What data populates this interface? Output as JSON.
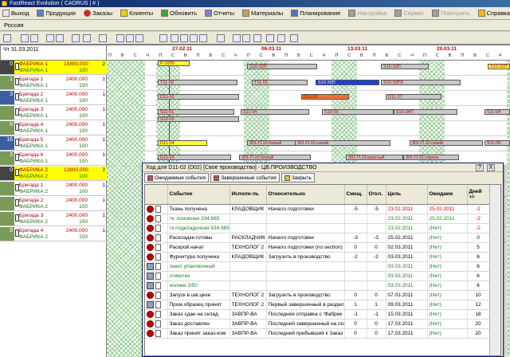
{
  "app": {
    "title": "FastReact Evolution  ( CADRUS | # )"
  },
  "menu": [
    {
      "label": "Выход",
      "icon": "exit-icon",
      "disabled": false
    },
    {
      "label": "Продукция",
      "icon": "product-icon",
      "disabled": false
    },
    {
      "label": "Заказы",
      "icon": "orders-icon",
      "disabled": false
    },
    {
      "label": "Клиенты",
      "icon": "clients-icon",
      "disabled": false
    },
    {
      "label": "Обновить",
      "icon": "refresh-icon",
      "disabled": false
    },
    {
      "label": "Отчеты",
      "icon": "reports-icon",
      "disabled": false
    },
    {
      "label": "Материалы",
      "icon": "materials-icon",
      "disabled": false
    },
    {
      "label": "Планирование",
      "icon": "planning-icon",
      "disabled": false
    },
    {
      "label": "Настройка",
      "icon": "settings-icon",
      "disabled": true
    },
    {
      "label": "Сервис",
      "icon": "service-icon",
      "disabled": true
    },
    {
      "label": "Повторить",
      "icon": "repeat-icon",
      "disabled": true
    },
    {
      "label": "Справка",
      "icon": "help-icon",
      "disabled": false
    }
  ],
  "region": "Россия",
  "current_date": "Чт 31.03.2011",
  "timeline": {
    "dates": [
      "27.02.11",
      "06.03.11",
      "13.03.11",
      "20.03.11"
    ],
    "days": [
      "П",
      "В",
      "С",
      "Ч",
      "П",
      "С",
      "В"
    ]
  },
  "resources": [
    {
      "num": "0",
      "name": "ФАБРИКА 1",
      "sub": "ФАБРИКА 1",
      "value": "15800,000",
      "sub_value": "100",
      "count": "2",
      "highlight": true
    },
    {
      "num": "1",
      "name": "Бригада 1",
      "sub": "ФАБРИКА 1",
      "value": "2400,000",
      "sub_value": "100",
      "count": "1",
      "highlight": false
    },
    {
      "num": "3",
      "name": "Бригада 2",
      "sub": "ФАБРИКА 1",
      "value": "2400,000",
      "sub_value": "100",
      "count": "1",
      "highlight": false
    },
    {
      "num": "",
      "name": "Бригада 3",
      "sub": "ФАБРИКА 1",
      "value": "2400,000",
      "sub_value": "100",
      "count": "1",
      "highlight": false
    },
    {
      "num": "8",
      "name": "Бригада 4",
      "sub": "ФАБРИКА 1",
      "value": "2400,000",
      "sub_value": "100",
      "count": "1",
      "highlight": false
    },
    {
      "num": "16",
      "name": "Бригада 5",
      "sub": "ФАБРИКА 1",
      "value": "2400,000",
      "sub_value": "100",
      "count": "1",
      "highlight": false
    },
    {
      "num": "3",
      "name": "Бригада 6",
      "sub": "ФАБРИКА 1",
      "value": "2400,000",
      "sub_value": "100",
      "count": "1",
      "highlight": false
    },
    {
      "num": "0",
      "name": "ФАБРИКА 2",
      "sub": "ФАБРИКА 2",
      "value": "12800,000",
      "sub_value": "100",
      "count": "2",
      "highlight": true
    },
    {
      "num": "",
      "name": "Бригада 1",
      "sub": "ФАБРИКА 2",
      "value": "2400,000",
      "sub_value": "100",
      "count": "1",
      "highlight": false
    },
    {
      "num": "",
      "name": "Бригада 2",
      "sub": "ФАБРИКА 2",
      "value": "2400,000",
      "sub_value": "100",
      "count": "1",
      "highlight": false
    },
    {
      "num": "",
      "name": "Бригада 3",
      "sub": "ФАБРИКА 2",
      "value": "2400,000",
      "sub_value": "100",
      "count": "1",
      "highlight": false
    },
    {
      "num": "8",
      "name": "Бригада 4",
      "sub": "ФАБРИКА 2",
      "value": "2400,000",
      "sub_value": "100",
      "count": "1",
      "highlight": false
    }
  ],
  "gantt_labels": [
    "P-1009",
    "S10-32П",
    "S10-33П",
    "S10-32П",
    "T11-02",
    "T11-01",
    "S10-33П",
    "S10-33П3",
    "D11-02",
    "D11-02",
    "D11-37",
    "S11-01",
    "S11-04",
    "S10-03",
    "S10-34П",
    "S11-04",
    "S10-03",
    "D11-04",
    "301-П.10:белый",
    "301-П.10:синий",
    "301-П.10:синий",
    "S11-05",
    "D11-03",
    "301-П.10:белый",
    "301-П.10:красный",
    "301-П.10:сирень"
  ],
  "dialog": {
    "title": "Ход для D11-02  (D02) [Свое производство] - ЦВ.ПРОИЗВОДСТВО",
    "help_btn": "?",
    "close_btn": "X",
    "tabs": [
      "Ожидаемые события",
      "Завершенные события",
      "Закрыть"
    ],
    "columns": [
      "Событие",
      "Исполн-ль",
      "Относительно",
      "Смещ.",
      "Откл.",
      "Цель",
      "Ожидаем",
      "Дней +/-"
    ],
    "rows": [
      {
        "event": "Ткань получена",
        "who": "КЛАДОВЩИК",
        "rel": "Начало подготовки",
        "shift": "-5",
        "dev": "-5",
        "target": "23.02.2011",
        "expected": "25.02.2011",
        "days": "-2",
        "color": "black",
        "target_red": true,
        "icon": "circle"
      },
      {
        "event": "тк. основная 334.665",
        "who": "",
        "rel": "",
        "shift": "",
        "dev": "",
        "target": "23.02.2011",
        "expected": "25.02.2011",
        "days": "-2",
        "color": "green",
        "target_red": false,
        "icon": "circle"
      },
      {
        "event": "тк.подкладочная 534.665",
        "who": "",
        "rel": "",
        "shift": "",
        "dev": "",
        "target": "23.02.2011",
        "expected": "(Нет)",
        "days": "-2",
        "color": "green",
        "target_red": false,
        "icon": "circle"
      },
      {
        "event": "Раскладки готовы",
        "who": "РАСКЛАДЧИК",
        "rel": "Начало подготовки",
        "shift": "-3",
        "dev": "-3",
        "target": "25.02.2011",
        "expected": "(Нет)",
        "days": "0",
        "color": "black",
        "target_red": false,
        "icon": "circle"
      },
      {
        "event": "Раскрой начат",
        "who": "ТЕХНОЛОГ 2",
        "rel": "Начало подготовки (no section)",
        "shift": "0",
        "dev": "0",
        "target": "02.03.2011",
        "expected": "(Нет)",
        "days": "5",
        "color": "black",
        "target_red": false,
        "icon": "circle"
      },
      {
        "event": "Фурнитура получена",
        "who": "КЛАДОВЩИК",
        "rel": "Загрузить в производство",
        "shift": "-2",
        "dev": "-2",
        "target": "03.03.2011",
        "expected": "(Нет)",
        "days": "6",
        "color": "black",
        "target_red": false,
        "icon": "circle"
      },
      {
        "event": "пакет упаковочный",
        "who": "",
        "rel": "",
        "shift": "",
        "dev": "",
        "target": "03.03.2011",
        "expected": "(Нет)",
        "days": "6",
        "color": "green",
        "target_red": false,
        "icon": "people"
      },
      {
        "event": "этикетки",
        "who": "",
        "rel": "",
        "shift": "",
        "dev": "",
        "target": "03.03.2011",
        "expected": "(Нет)",
        "days": "6",
        "color": "green",
        "target_red": false,
        "icon": "people"
      },
      {
        "event": "нолики 3/50",
        "who": "",
        "rel": "",
        "shift": "",
        "dev": "",
        "target": "03.03.2011",
        "expected": "(Нет)",
        "days": "6",
        "color": "green",
        "target_red": false,
        "icon": "people"
      },
      {
        "event": "Запуск в шв.цехе",
        "who": "ТЕХНОЛОГ 2",
        "rel": "Загрузить в производство",
        "shift": "0",
        "dev": "0",
        "target": "07.03.2011",
        "expected": "(Нет)",
        "days": "10",
        "color": "black",
        "target_red": false,
        "icon": "circle"
      },
      {
        "event": "Пром.образец принят",
        "who": "ТЕХНОЛОГ 2",
        "rel": "Первый завершенный в раздел",
        "shift": "1",
        "dev": "1",
        "target": "09.03.2011",
        "expected": "(Нет)",
        "days": "12",
        "color": "black",
        "target_red": false,
        "icon": "people"
      },
      {
        "event": "Заказ сдан на склад",
        "who": "ЗАВПР-ВА",
        "rel": "Последняя отправка с 'Фабрик",
        "shift": "-1",
        "dev": "-1",
        "target": "15.03.2011",
        "expected": "(Нет)",
        "days": "18",
        "color": "black",
        "target_red": false,
        "icon": "circle"
      },
      {
        "event": "Заказ доставлен",
        "who": "ЗАВПР-ВА",
        "rel": "Последний завершенный на скл",
        "shift": "0",
        "dev": "0",
        "target": "17.03.2011",
        "expected": "(Нет)",
        "days": "20",
        "color": "black",
        "target_red": false,
        "icon": "circle"
      },
      {
        "event": "Заказ принят заказ-ком",
        "who": "ЗАВПР-ВА",
        "rel": "Последний прибывший к Заказ",
        "shift": "0",
        "dev": "0",
        "target": "17.03.2011",
        "expected": "(Нет)",
        "days": "20",
        "color": "black",
        "target_red": false,
        "icon": "circle"
      }
    ]
  },
  "colors": {
    "accent": "#0a246a",
    "warning_yellow": "#ffff00",
    "bar_blue": "#1e40d0",
    "bar_orange": "#f07030",
    "bar_gray": "#c8c8c8",
    "status_red": "#c00000"
  }
}
